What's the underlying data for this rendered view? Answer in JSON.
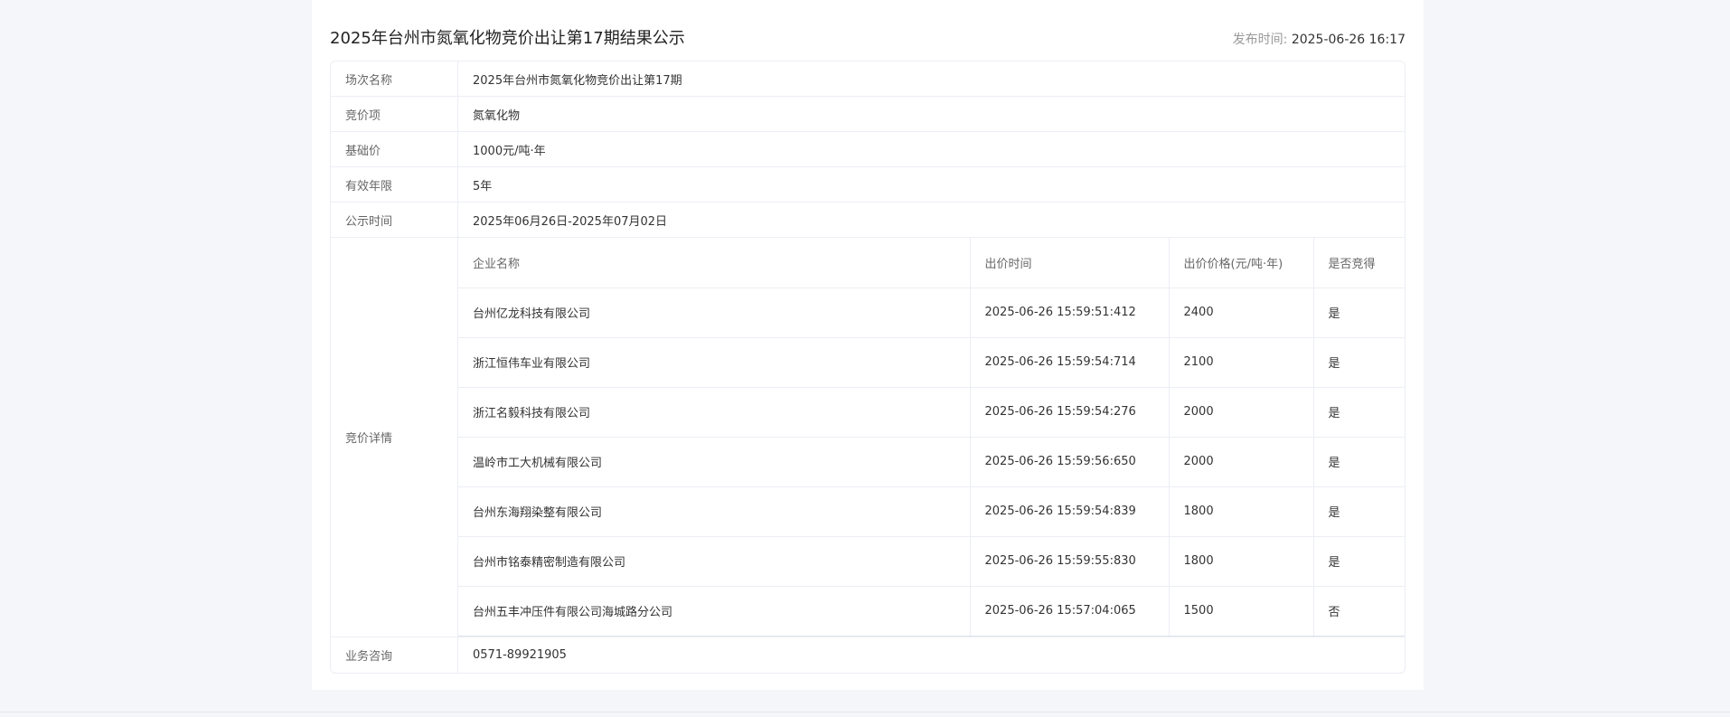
{
  "notice": {
    "title": "2025年台州市氮氧化物竞价出让第17期结果公示",
    "publish_label": "发布时间:",
    "publish_time": "2025-06-26 16:17"
  },
  "info_rows": [
    {
      "label": "场次名称",
      "value": "2025年台州市氮氧化物竞价出让第17期"
    },
    {
      "label": "竞价项",
      "value": "氮氧化物"
    },
    {
      "label": "基础价",
      "value": "1000元/吨·年"
    },
    {
      "label": "有效年限",
      "value": "5年"
    },
    {
      "label": "公示时间",
      "value": "2025年06月26日-2025年07月02日"
    }
  ],
  "bid_details": {
    "label": "竞价详情",
    "headers": {
      "company": "企业名称",
      "time": "出价时间",
      "price": "出价价格(元/吨·年)",
      "won": "是否竞得"
    },
    "rows": [
      {
        "company": "台州亿龙科技有限公司",
        "time": "2025-06-26 15:59:51:412",
        "price": "2400",
        "won": "是"
      },
      {
        "company": "浙江恒伟车业有限公司",
        "time": "2025-06-26 15:59:54:714",
        "price": "2100",
        "won": "是"
      },
      {
        "company": "浙江名毅科技有限公司",
        "time": "2025-06-26 15:59:54:276",
        "price": "2000",
        "won": "是"
      },
      {
        "company": "温岭市工大机械有限公司",
        "time": "2025-06-26 15:59:56:650",
        "price": "2000",
        "won": "是"
      },
      {
        "company": "台州东海翔染整有限公司",
        "time": "2025-06-26 15:59:54:839",
        "price": "1800",
        "won": "是"
      },
      {
        "company": "台州市铭泰精密制造有限公司",
        "time": "2025-06-26 15:59:55:830",
        "price": "1800",
        "won": "是"
      },
      {
        "company": "台州五丰冲压件有限公司海城路分公司",
        "time": "2025-06-26 15:57:04:065",
        "price": "1500",
        "won": "否"
      }
    ]
  },
  "consult": {
    "label": "业务咨询",
    "value": "0571-89921905"
  }
}
